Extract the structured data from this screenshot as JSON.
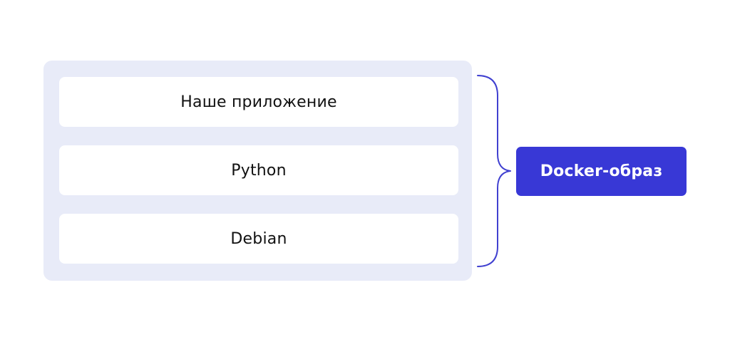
{
  "layers": [
    {
      "label": "Наше приложение"
    },
    {
      "label": "Python"
    },
    {
      "label": "Debian"
    }
  ],
  "image_label": "Docker-образ",
  "colors": {
    "container_bg": "#e8ebf8",
    "layer_bg": "#ffffff",
    "accent": "#3838d6",
    "brace": "#4040d0"
  },
  "icons": [
    "curly-brace"
  ]
}
